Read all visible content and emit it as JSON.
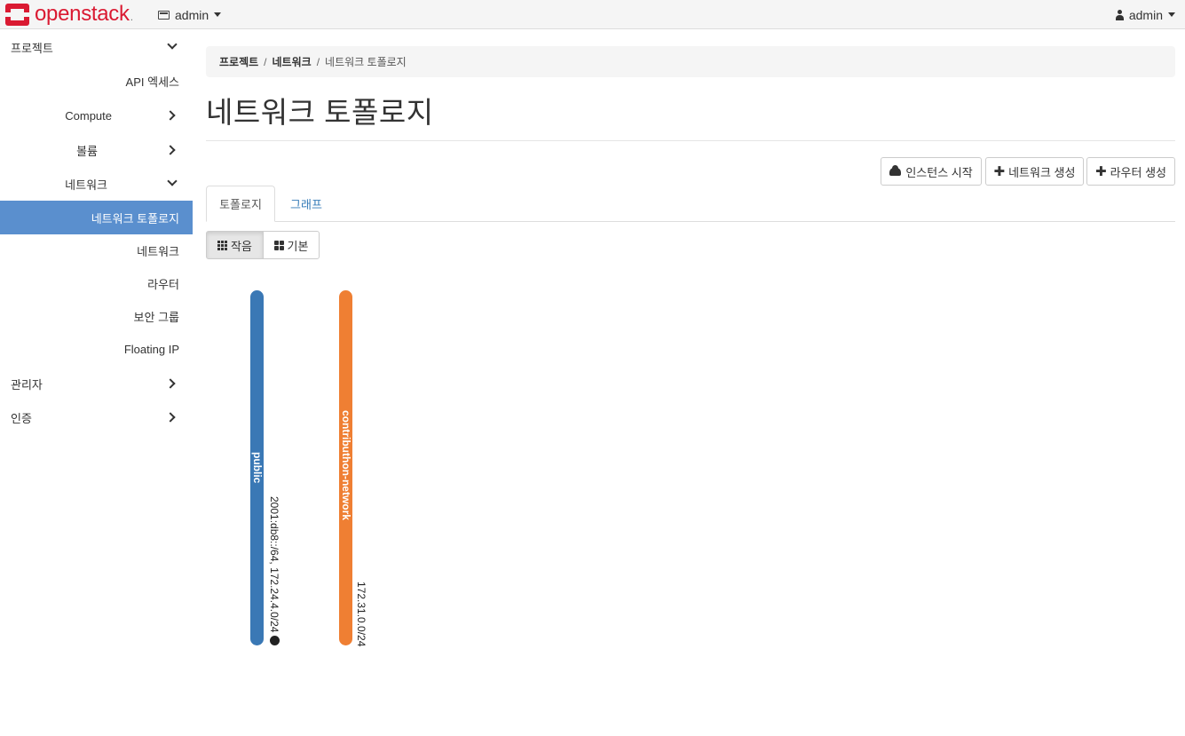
{
  "navbar": {
    "brand": "openstack",
    "brand_suffix": ".",
    "project_menu": "admin",
    "user_menu": "admin"
  },
  "sidebar": {
    "project": "프로젝트",
    "api_access": "API 엑세스",
    "compute": "Compute",
    "volume": "볼륨",
    "network": "네트워크",
    "network_topology": "네트워크 토폴로지",
    "networks": "네트워크",
    "routers": "라우터",
    "security_groups": "보안 그룹",
    "floating_ip": "Floating IP",
    "admin": "관리자",
    "identity": "인증"
  },
  "breadcrumb": {
    "item1": "프로젝트",
    "item2": "네트워크",
    "current": "네트워크 토폴로지",
    "sep": "/"
  },
  "page_title": "네트워크 토폴로지",
  "actions": {
    "launch_instance": "인스턴스 시작",
    "create_network": "네트워크 생성",
    "create_router": "라우터 생성",
    "plus": "✚"
  },
  "tabs": {
    "topology": "토폴로지",
    "graph": "그래프"
  },
  "view_toggle": {
    "small": "작음",
    "normal": "기본"
  },
  "networks": {
    "public": {
      "name": "public",
      "cidr": "2001:db8::/64, 172.24.4.0/24",
      "color": "#3a78b5"
    },
    "contribution": {
      "name": "contributhon-network",
      "cidr": "172.31.0.0/24",
      "color": "#ef7f33"
    }
  }
}
